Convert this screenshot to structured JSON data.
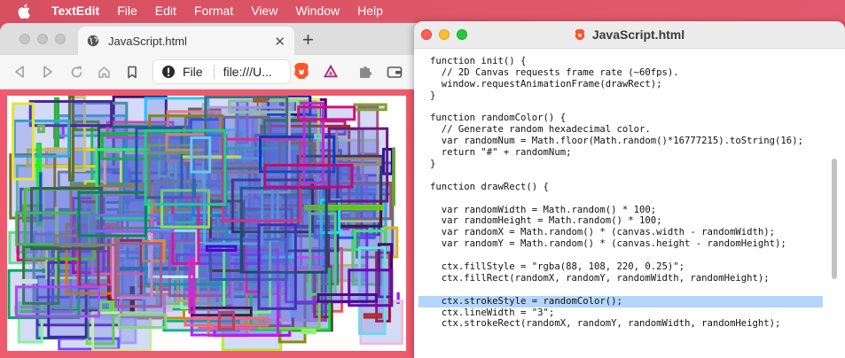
{
  "menubar": {
    "app_name": "TextEdit",
    "items": [
      "File",
      "Edit",
      "Format",
      "View",
      "Window",
      "Help"
    ]
  },
  "browser": {
    "tab_title": "JavaScript.html",
    "url_label": "File",
    "url_text": "file:///U..."
  },
  "textedit": {
    "title": "JavaScript.html",
    "lines": [
      "function init() {",
      "  // 2D Canvas requests frame rate (~60fps).",
      "  window.requestAnimationFrame(drawRect);",
      "}",
      "",
      "function randomColor() {",
      "  // Generate random hexadecimal color.",
      "  var randomNum = Math.floor(Math.random()*16777215).toString(16);",
      "  return \"#\" + randomNum;",
      "}",
      "",
      "function drawRect() {",
      "",
      "  var randomWidth = Math.random() * 100;",
      "  var randomHeight = Math.random() * 100;",
      "  var randomX = Math.random() * (canvas.width - randomWidth);",
      "  var randomY = Math.random() * (canvas.height - randomHeight);",
      "",
      "  ctx.fillStyle = \"rgba(88, 108, 220, 0.25)\";",
      "  ctx.fillRect(randomX, randomY, randomWidth, randomHeight);",
      "",
      "  ctx.strokeStyle = randomColor();",
      "  ctx.lineWidth = \"3\";",
      "  ctx.strokeRect(randomX, randomY, randomWidth, randomHeight);"
    ],
    "highlighted_line": 21
  },
  "colors": {
    "desktop": "#e45a6c",
    "selection": "#b4d5fc",
    "rect_fill": "rgba(88, 108, 220, 0.25)"
  },
  "icons": {
    "apple": "apple-icon",
    "globe": "globe-icon",
    "brave": "brave-lion-icon",
    "rewards": "brave-rewards-icon",
    "extensions": "puzzle-icon",
    "wallet": "wallet-icon"
  }
}
